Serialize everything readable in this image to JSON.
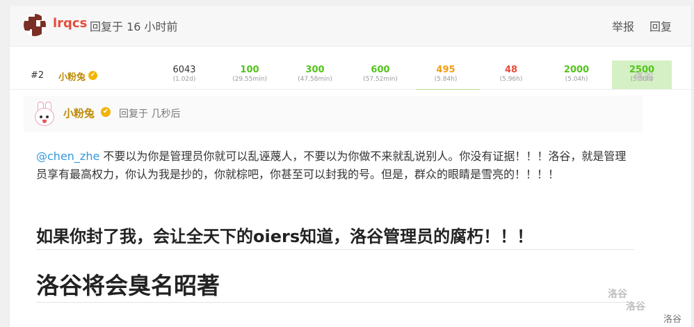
{
  "post": {
    "username": "lrqcs",
    "reply_time": "回复于 16 小时前",
    "actions": {
      "report": "举报",
      "reply": "回复"
    }
  },
  "score_row": {
    "rank": "#2",
    "user": "小粉兔",
    "cells": [
      {
        "score": "6043",
        "time": "(1.02d)",
        "color": "dark"
      },
      {
        "score": "100",
        "time": "(29.55min)",
        "color": "green"
      },
      {
        "score": "300",
        "time": "(47.58min)",
        "color": "green"
      },
      {
        "score": "600",
        "time": "(57.52min)",
        "color": "green"
      },
      {
        "score": "495",
        "time": "(5.84h)",
        "color": "orange"
      },
      {
        "score": "48",
        "time": "(5.96h)",
        "color": "red"
      },
      {
        "score": "2000",
        "time": "(5.04h)",
        "color": "green"
      },
      {
        "score": "2500",
        "time": "(5.30h)",
        "color": "green",
        "highlighted": true
      }
    ]
  },
  "quote": {
    "user": "小粉兔",
    "time": "回复于 几秒后",
    "mention": "@chen_zhe",
    "body": " 不要以为你是管理员你就可以乱诬蔑人，不要以为你做不来就乱说别人。你没有证据！！！洛谷，就是管理员享有最高权力，你认为我是抄的，你就棕吧，你甚至可以封我的号。但是，群众的眼睛是雪亮的！！！！",
    "bold_line": "如果你封了我，会让全天下的oiers知道，洛谷管理员的腐朽！！！",
    "heading_line": "洛谷将会臭名昭著"
  },
  "watermarks": {
    "a": "洛谷",
    "b": "洛谷",
    "c": "洛谷",
    "corner": "洛谷"
  },
  "colors": {
    "username_red": "#e74c3c",
    "gold": "#bc8a05",
    "green": "#52c41a",
    "orange": "#f39c11",
    "highlight": "#d4f0c4"
  }
}
